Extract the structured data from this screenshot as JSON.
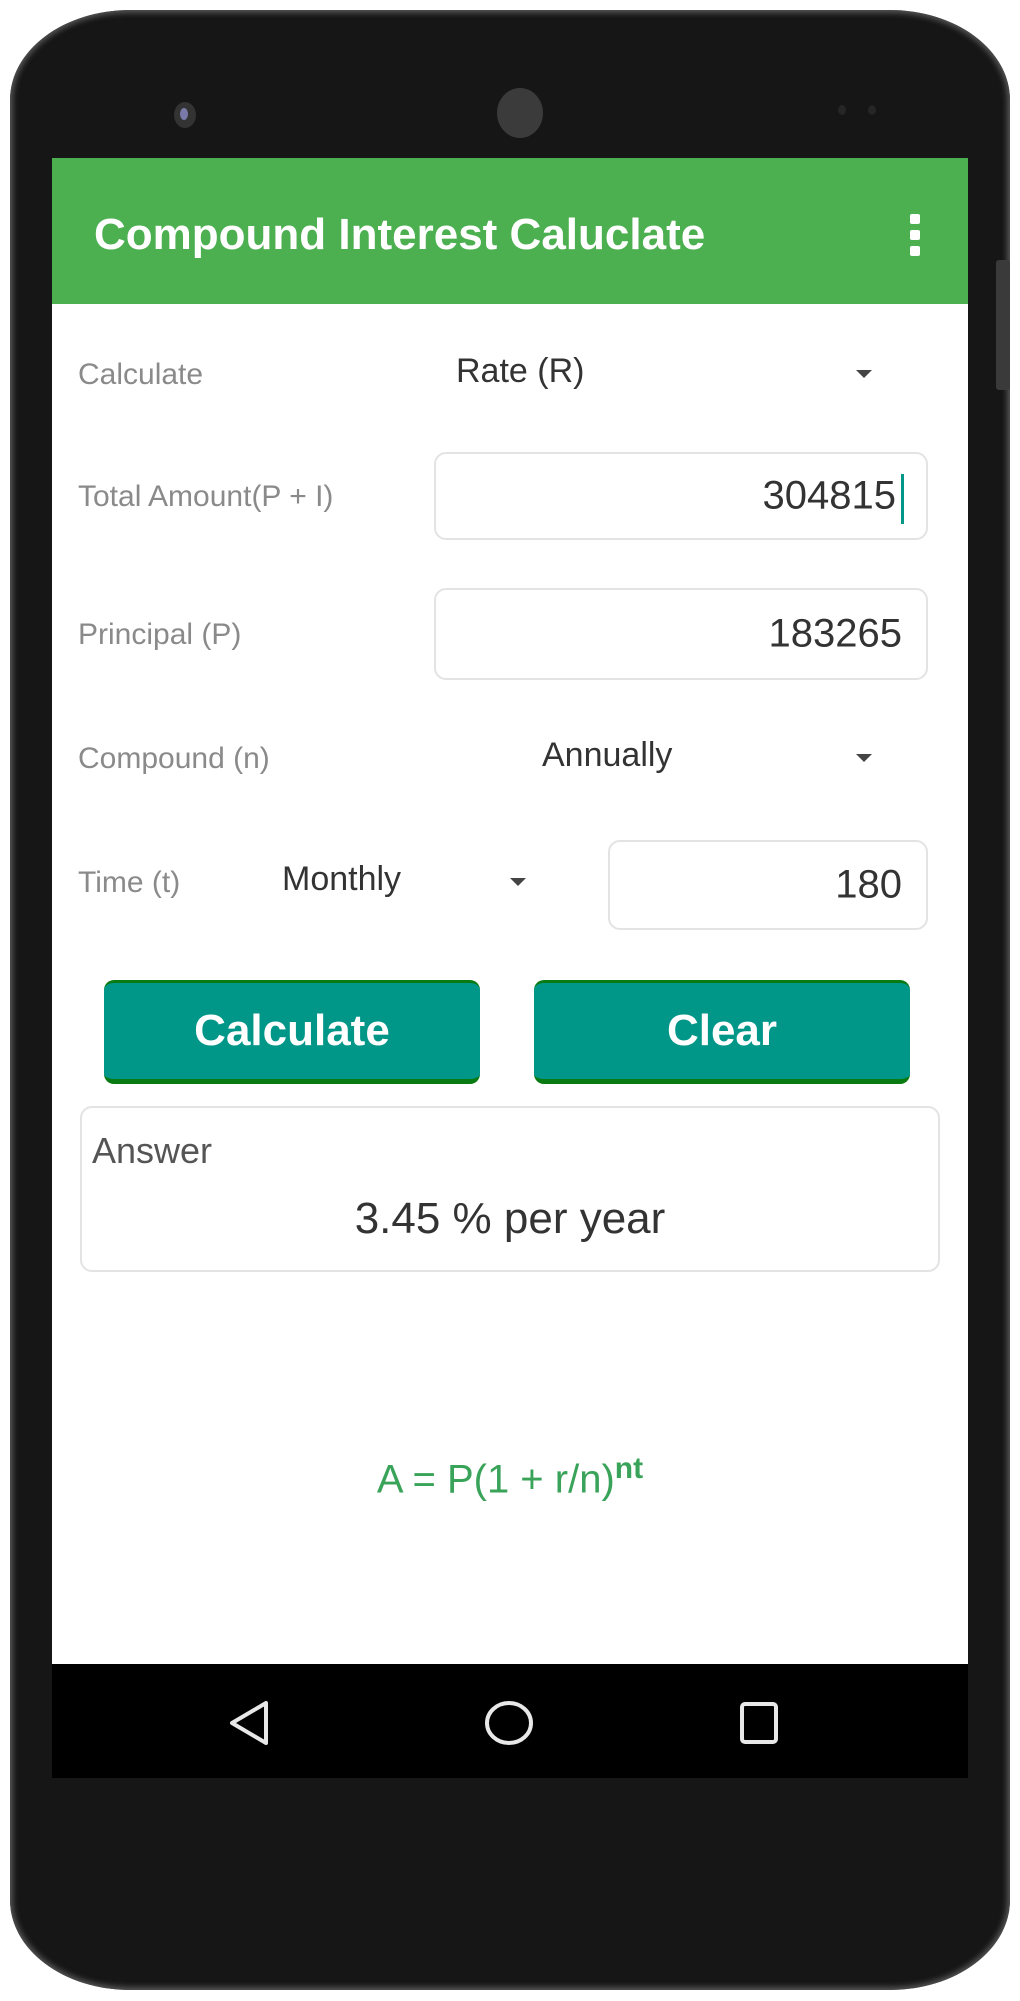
{
  "app": {
    "title": "Compound Interest Caluclate",
    "overflow_menu_icon": "more-vert-icon"
  },
  "form": {
    "calculate": {
      "label": "Calculate",
      "selected": "Rate (R)"
    },
    "total_amount": {
      "label": "Total Amount(P + I)",
      "value": "304815"
    },
    "principal": {
      "label": "Principal (P)",
      "value": "183265"
    },
    "compound": {
      "label": "Compound (n)",
      "selected": "Annually"
    },
    "time": {
      "label": "Time (t)",
      "unit_selected": "Monthly",
      "value": "180"
    }
  },
  "buttons": {
    "calculate": "Calculate",
    "clear": "Clear"
  },
  "answer": {
    "title": "Answer",
    "value": "3.45 % per year"
  },
  "formula": {
    "base": "A = P(1 + r/n)",
    "exponent": "nt"
  },
  "navbar": {
    "back_icon": "back-triangle-icon",
    "home_icon": "home-circle-icon",
    "recents_icon": "recents-square-icon"
  },
  "colors": {
    "appbar": "#4caf50",
    "button": "#009688",
    "formula": "#3aa35a"
  }
}
